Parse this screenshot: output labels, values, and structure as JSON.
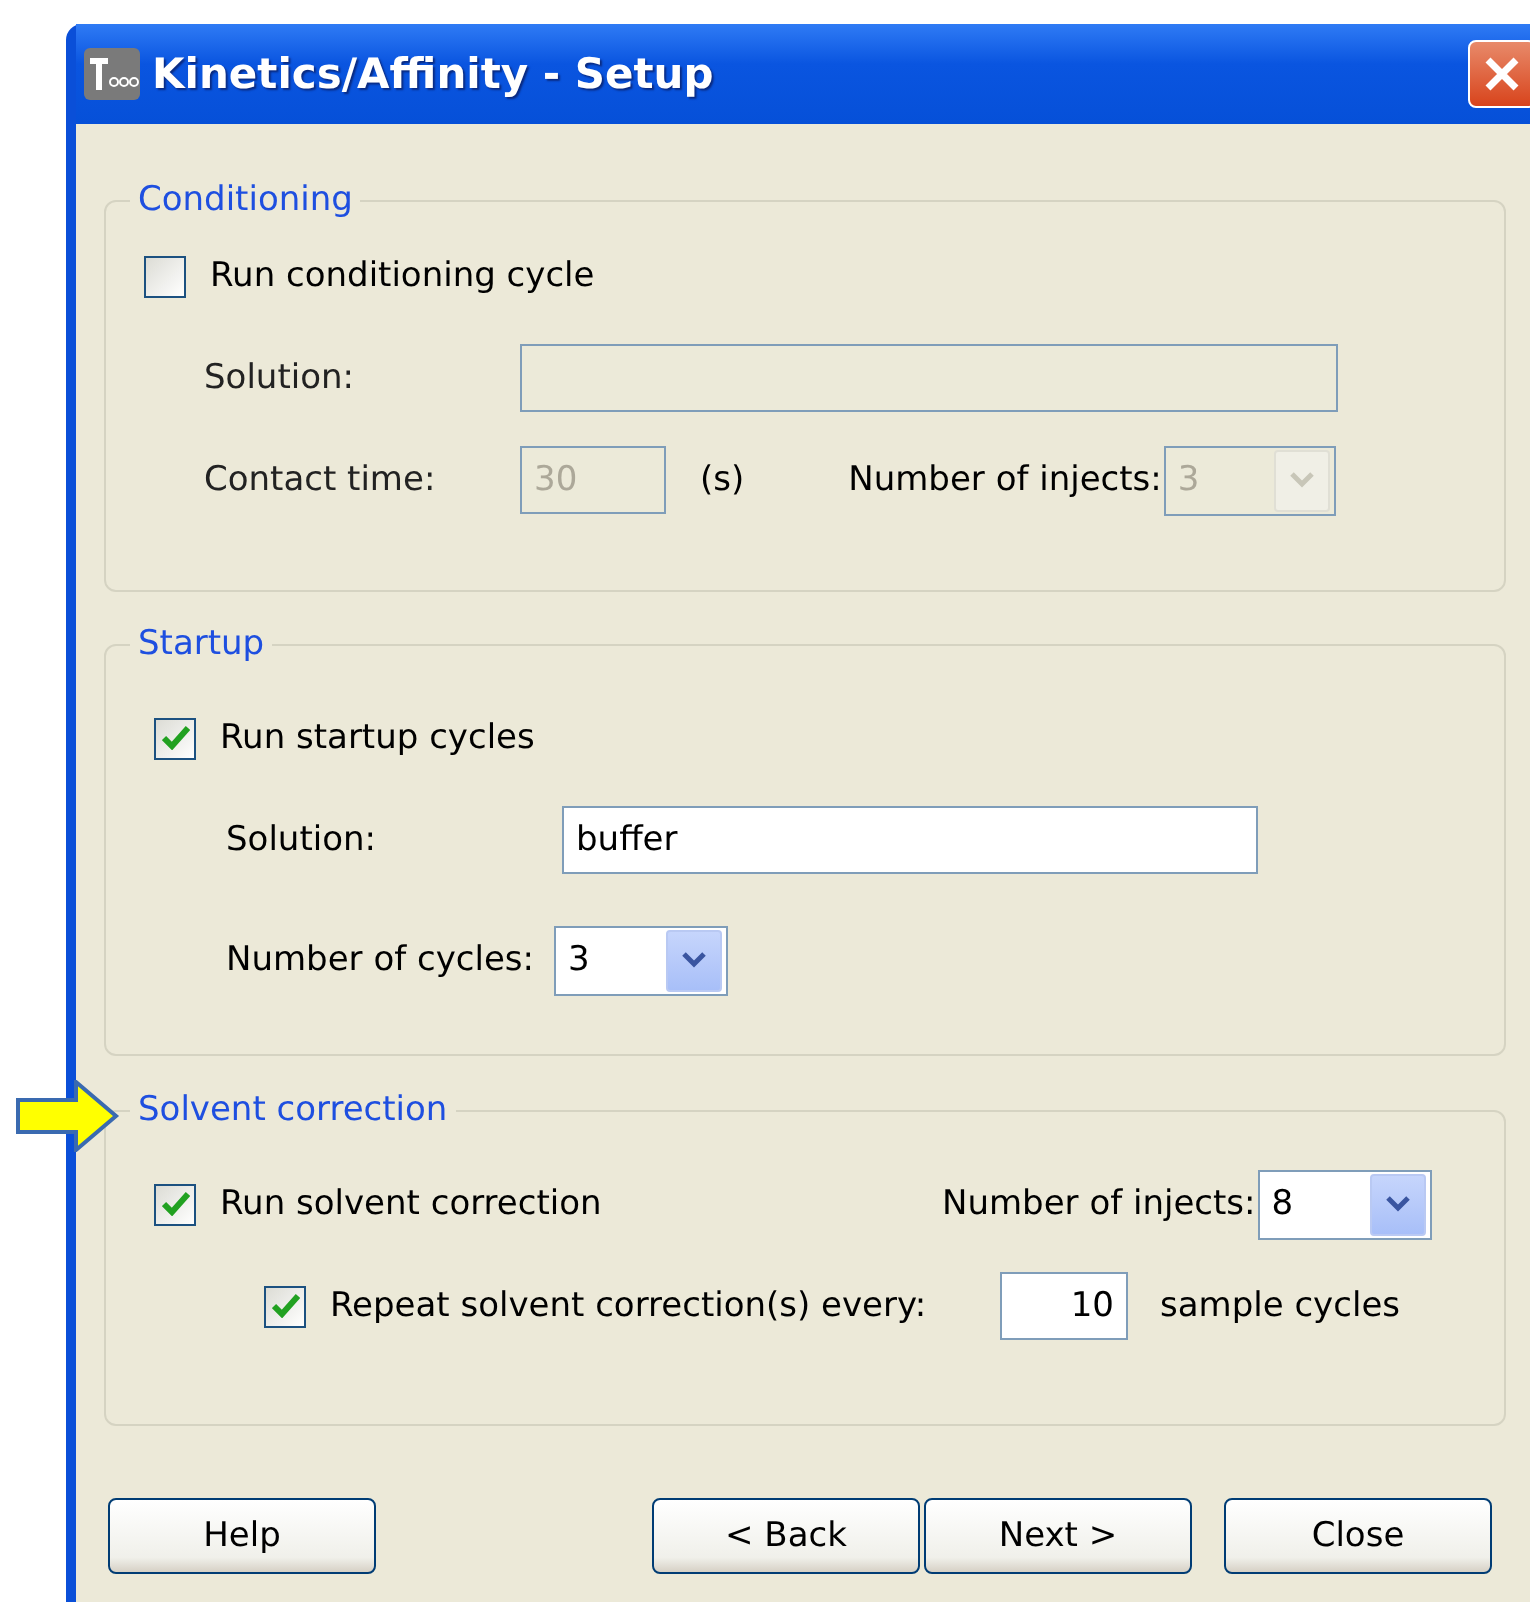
{
  "window": {
    "title": "Kinetics/Affinity - Setup"
  },
  "conditioning": {
    "legend": "Conditioning",
    "run": {
      "label": "Run conditioning cycle",
      "checked": false
    },
    "solution": {
      "label": "Solution:",
      "disabled": true
    },
    "contact_time": {
      "label": "Contact time:",
      "value": "30",
      "unit": "(s)",
      "disabled": true
    },
    "injects": {
      "label": "Number of injects:",
      "value": "3",
      "disabled": true
    }
  },
  "startup": {
    "legend": "Startup",
    "run": {
      "label": "Run startup cycles",
      "checked": true
    },
    "solution": {
      "label": "Solution:",
      "value": "buffer",
      "disabled": false
    },
    "cycles": {
      "label": "Number of cycles:",
      "value": "3",
      "disabled": false
    }
  },
  "solvent_correction": {
    "legend": "Solvent correction",
    "highlighted": true,
    "run": {
      "label": "Run solvent correction",
      "checked": true
    },
    "injects": {
      "label": "Number of injects:",
      "value": "8",
      "disabled": false
    },
    "repeat": {
      "label": "Repeat solvent correction(s) every:",
      "checked": true,
      "value": "10",
      "unit": "sample cycles"
    }
  },
  "buttons": [
    {
      "label": "Help"
    },
    {
      "label": "< Back"
    },
    {
      "label": "Next >"
    },
    {
      "label": "Close"
    }
  ]
}
